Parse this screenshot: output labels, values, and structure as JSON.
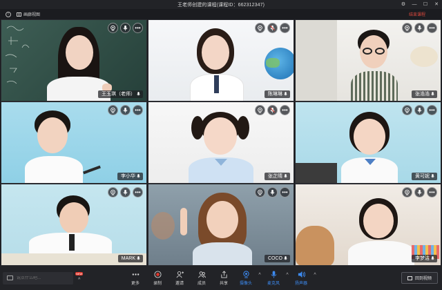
{
  "window": {
    "title": "王老师创建的课程(课程ID：662312347)",
    "controls": [
      "⚙",
      "—",
      "☐",
      "✕"
    ]
  },
  "toolbar": {
    "layout_label": "画廊视图",
    "end_label": "结束课程"
  },
  "participants": [
    {
      "name": "王玉琪（老师）",
      "tile": "teacher"
    },
    {
      "name": "陈琳琳",
      "tile": "girl-globe"
    },
    {
      "name": "张浩浩",
      "tile": "boy-glasses"
    },
    {
      "name": "李小华",
      "tile": "boy-blue"
    },
    {
      "name": "张芷晴",
      "tile": "girl-pigtails"
    },
    {
      "name": "黄可妮",
      "tile": "girl-blue"
    },
    {
      "name": "MARK",
      "tile": "boy-writing"
    },
    {
      "name": "COCO",
      "tile": "girl-hand"
    },
    {
      "name": "李梦洁",
      "tile": "girl-dog"
    }
  ],
  "tile_icons": [
    "camera-icon",
    "microphone-icon",
    "more-icon"
  ],
  "bottom": {
    "chat_placeholder": "说点什么吧...",
    "new_badge": "NEW",
    "tools": [
      {
        "label": "更多",
        "icon": "more-icon"
      },
      {
        "label": "录制",
        "icon": "record-icon"
      },
      {
        "label": "邀请",
        "icon": "invite-icon"
      },
      {
        "label": "成员",
        "icon": "members-icon"
      },
      {
        "label": "共享",
        "icon": "share-icon"
      },
      {
        "label": "摄像头",
        "icon": "camera-icon"
      },
      {
        "label": "麦克风",
        "icon": "microphone-icon"
      },
      {
        "label": "扬声器",
        "icon": "speaker-icon"
      }
    ],
    "back_label": "回到视频"
  },
  "colors": {
    "accent": "#3d8bf2",
    "danger": "#e0382d",
    "background": "#1b1c20"
  }
}
